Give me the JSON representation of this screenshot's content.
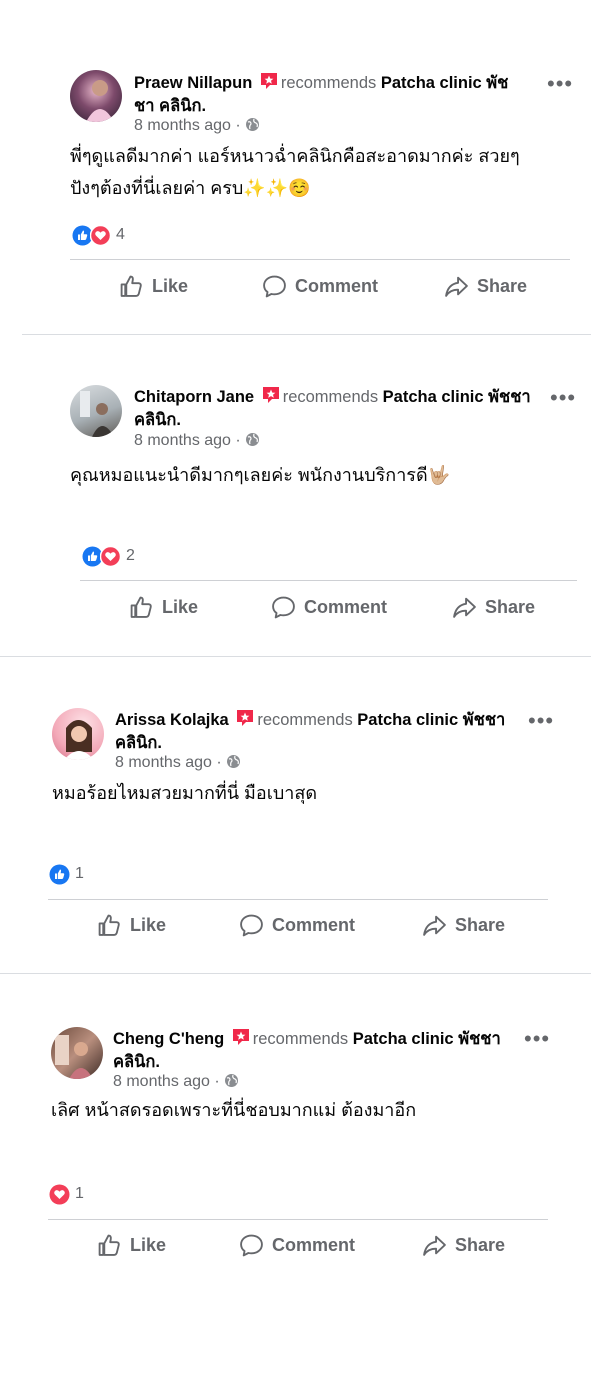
{
  "posts": [
    {
      "author": "Praew Nillapun",
      "recommends": "recommends",
      "page": "Patcha clinic พัชชา คลินิก.",
      "time": "8 months ago",
      "text_lines": [
        "พี่ๆดูแลดีมากค่า แอร์หนาวฉ่ำคลินิกคือสะอาดมากค่ะ สวยๆ",
        "ปังๆต้องที่นี่เลยค่า ครบ✨✨☺️"
      ],
      "reactions": [
        "like",
        "love"
      ],
      "reaction_count": "4"
    },
    {
      "author": "Chitaporn Jane",
      "recommends": "recommends",
      "page": "Patcha clinic พัชชา คลินิก.",
      "time": "8 months ago",
      "text_lines": [
        "คุณหมอแนะนำดีมากๆเลยค่ะ พนักงานบริการดี🤟🏼"
      ],
      "reactions": [
        "like",
        "love"
      ],
      "reaction_count": "2"
    },
    {
      "author": "Arissa Kolajka",
      "recommends": "recommends",
      "page": "Patcha clinic พัชชา คลินิก.",
      "time": "8 months ago",
      "text_lines": [
        "หมอร้อยไหมสวยมากที่นี่ มือเบาสุด"
      ],
      "reactions": [
        "like"
      ],
      "reaction_count": "1"
    },
    {
      "author": "Cheng C'heng",
      "recommends": "recommends",
      "page": "Patcha clinic พัชชา คลินิก.",
      "time": "8 months ago",
      "text_lines": [
        "เลิศ หน้าสดรอดเพราะที่นี่ชอบมากแม่ ต้องมาอีก"
      ],
      "reactions": [
        "love"
      ],
      "reaction_count": "1"
    }
  ],
  "actions": {
    "like": "Like",
    "comment": "Comment",
    "share": "Share"
  },
  "more_label": "•••",
  "colors": {
    "like_blue": "#1877f2",
    "love_red": "#f33e58",
    "recommend_red": "#f0284a",
    "secondary_text": "#65676b"
  }
}
